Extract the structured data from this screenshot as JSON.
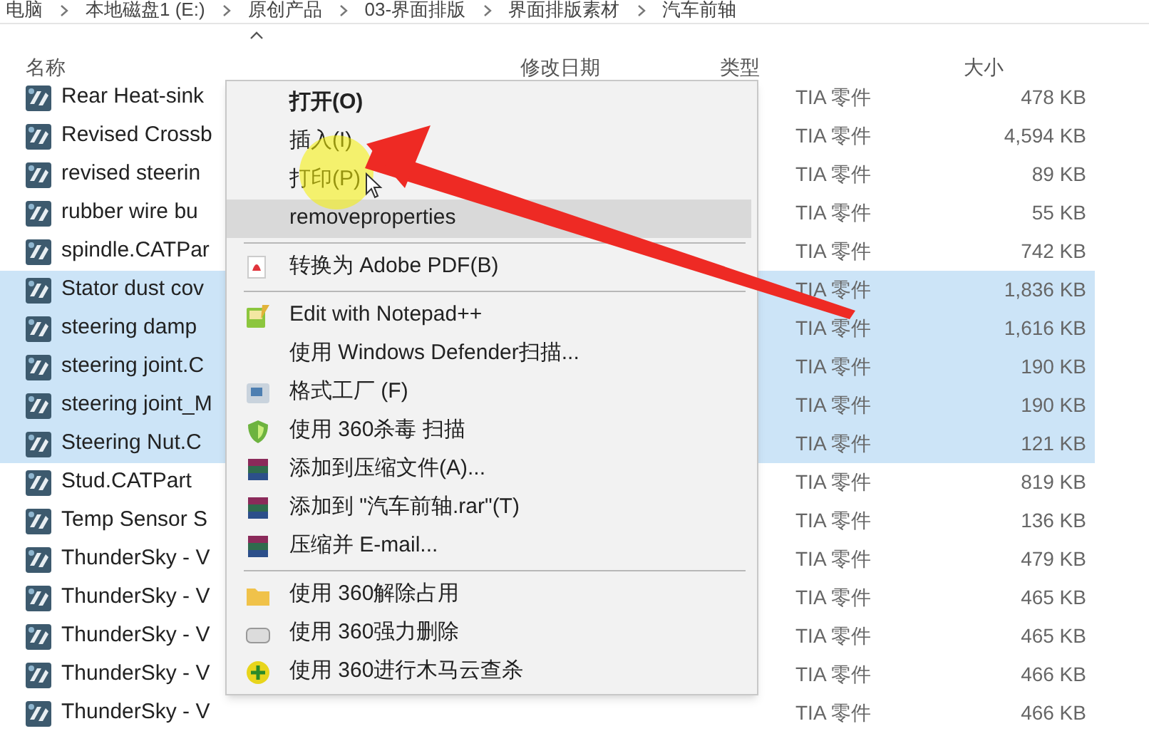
{
  "breadcrumb": [
    "电脑",
    "本地磁盘1 (E:)",
    "原创产品",
    "03-界面排版",
    "界面排版素材",
    "汽车前轴"
  ],
  "columns": [
    {
      "label": "名称"
    },
    {
      "label": "修改日期"
    },
    {
      "label": "类型"
    },
    {
      "label": "大小"
    }
  ],
  "rows": [
    {
      "name": "Rear Heat-sink",
      "type": "TIA 零件",
      "size": "478 KB",
      "selected": false
    },
    {
      "name": "Revised Crossb",
      "type": "TIA 零件",
      "size": "4,594 KB",
      "selected": false
    },
    {
      "name": "revised steerin",
      "type": "TIA 零件",
      "size": "89 KB",
      "selected": false
    },
    {
      "name": "rubber wire bu",
      "type": "TIA 零件",
      "size": "55 KB",
      "selected": false
    },
    {
      "name": "spindle.CATPar",
      "type": "TIA 零件",
      "size": "742 KB",
      "selected": false
    },
    {
      "name": "Stator dust cov",
      "type": "TIA 零件",
      "size": "1,836 KB",
      "selected": true
    },
    {
      "name": "steering damp",
      "type": "TIA 零件",
      "size": "1,616 KB",
      "selected": true
    },
    {
      "name": "steering joint.C",
      "type": "TIA 零件",
      "size": "190 KB",
      "selected": true
    },
    {
      "name": "steering joint_M",
      "type": "TIA 零件",
      "size": "190 KB",
      "selected": true
    },
    {
      "name": "Steering Nut.C",
      "type": "TIA 零件",
      "size": "121 KB",
      "selected": true
    },
    {
      "name": "Stud.CATPart",
      "type": "TIA 零件",
      "size": "819 KB",
      "selected": false
    },
    {
      "name": "Temp Sensor S",
      "type": "TIA 零件",
      "size": "136 KB",
      "selected": false
    },
    {
      "name": "ThunderSky - V",
      "type": "TIA 零件",
      "size": "479 KB",
      "selected": false
    },
    {
      "name": "ThunderSky - V",
      "type": "TIA 零件",
      "size": "465 KB",
      "selected": false
    },
    {
      "name": "ThunderSky - V",
      "type": "TIA 零件",
      "size": "465 KB",
      "selected": false
    },
    {
      "name": "ThunderSky - V",
      "type": "TIA 零件",
      "size": "466 KB",
      "selected": false
    },
    {
      "name": "ThunderSky - V",
      "type": "TIA 零件",
      "size": "466 KB",
      "selected": false
    }
  ],
  "context_menu": {
    "items": [
      {
        "kind": "plain",
        "label": "打开(O)",
        "bold": true,
        "highlighted": false
      },
      {
        "kind": "plain",
        "label": "插入(I)",
        "bold": false,
        "highlighted": false
      },
      {
        "kind": "plain",
        "label": "打印(P)",
        "bold": false,
        "highlighted": false
      },
      {
        "kind": "plain",
        "label": "removeproperties",
        "bold": false,
        "highlighted": true
      },
      {
        "kind": "separator"
      },
      {
        "kind": "pdf",
        "label": "转换为 Adobe PDF(B)",
        "bold": false,
        "highlighted": false
      },
      {
        "kind": "separator"
      },
      {
        "kind": "notepad",
        "label": "Edit with Notepad++",
        "bold": false,
        "highlighted": false
      },
      {
        "kind": "plain",
        "label": "使用 Windows Defender扫描...",
        "bold": false,
        "highlighted": false
      },
      {
        "kind": "factory",
        "label": "格式工厂 (F)",
        "bold": false,
        "highlighted": false
      },
      {
        "kind": "shield",
        "label": "使用 360杀毒 扫描",
        "bold": false,
        "highlighted": false
      },
      {
        "kind": "archive",
        "label": "添加到压缩文件(A)...",
        "bold": false,
        "highlighted": false
      },
      {
        "kind": "archive",
        "label": "添加到 \"汽车前轴.rar\"(T)",
        "bold": false,
        "highlighted": false
      },
      {
        "kind": "archive",
        "label": "压缩并 E-mail...",
        "bold": false,
        "highlighted": false
      },
      {
        "kind": "separator"
      },
      {
        "kind": "folder",
        "label": "使用 360解除占用",
        "bold": false,
        "highlighted": false
      },
      {
        "kind": "drive",
        "label": "使用 360强力删除",
        "bold": false,
        "highlighted": false
      },
      {
        "kind": "plus",
        "label": "使用 360进行木马云查杀",
        "bold": false,
        "highlighted": false
      }
    ]
  }
}
